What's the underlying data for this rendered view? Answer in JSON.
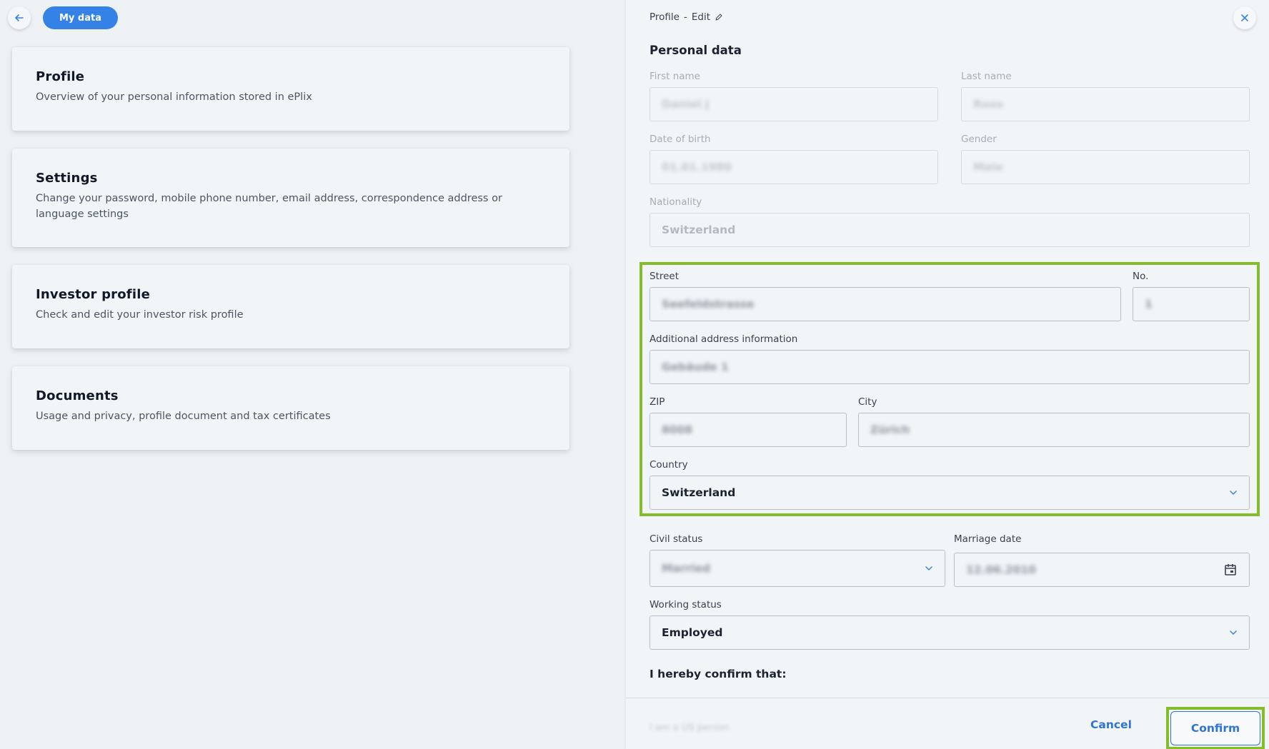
{
  "header": {
    "back_icon": "arrow-left-icon",
    "tab_label": "My data"
  },
  "cards": [
    {
      "title": "Profile",
      "description": "Overview of your personal information stored in ePlix"
    },
    {
      "title": "Settings",
      "description": "Change your password, mobile phone number, email address, correspondence address or language settings"
    },
    {
      "title": "Investor profile",
      "description": "Check and edit your investor risk profile"
    },
    {
      "title": "Documents",
      "description": "Usage and privacy, profile document and tax certificates"
    }
  ],
  "panel": {
    "breadcrumb": {
      "section": "Profile",
      "separator": "-",
      "mode": "Edit"
    },
    "close_icon": "close-icon",
    "title": "Personal data",
    "fields": {
      "first_name": {
        "label": "First name",
        "value": "Daniel J"
      },
      "last_name": {
        "label": "Last name",
        "value": "Roos"
      },
      "date_of_birth": {
        "label": "Date of birth",
        "value": "01.01.1980"
      },
      "gender": {
        "label": "Gender",
        "value": "Male"
      },
      "nationality": {
        "label": "Nationality",
        "value": "Switzerland"
      },
      "street": {
        "label": "Street",
        "value": "Seefeldstrasse"
      },
      "number": {
        "label": "No.",
        "value": "1"
      },
      "additional": {
        "label": "Additional address information",
        "value": "Gebäude 1"
      },
      "zip": {
        "label": "ZIP",
        "value": "8008"
      },
      "city": {
        "label": "City",
        "value": "Zürich"
      },
      "country": {
        "label": "Country",
        "value": "Switzerland"
      },
      "civil_status": {
        "label": "Civil status",
        "value": "Married"
      },
      "marriage_date": {
        "label": "Marriage date",
        "value": "12.06.2010"
      },
      "working_status": {
        "label": "Working status",
        "value": "Employed"
      }
    },
    "confirm_heading": "I hereby confirm that:",
    "confirm_line": "I am a US person",
    "buttons": {
      "cancel": "Cancel",
      "confirm": "Confirm"
    },
    "highlight_color": "#84bd2a",
    "accent_color": "#3482e6"
  }
}
